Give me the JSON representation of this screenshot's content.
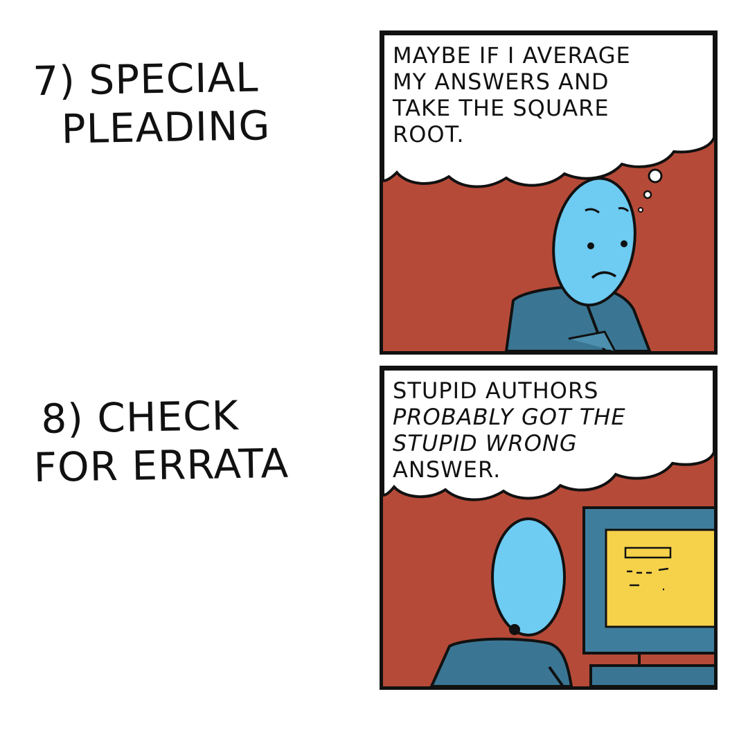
{
  "comic": {
    "step7": {
      "label_lines": [
        "7) SPECIAL",
        "PLEADING"
      ],
      "thought_lines": [
        "MAYBE IF I AVERAGE",
        "MY ANSWERS AND",
        "TAKE THE SQUARE",
        "ROOT."
      ]
    },
    "step8": {
      "label_lines": [
        "8) CHECK",
        "FOR ERRATA"
      ],
      "thought_lines": [
        "STUPID AUTHORS",
        "PROBABLY GOT THE",
        "STUPID WRONG",
        "ANSWER."
      ]
    }
  },
  "colors": {
    "background": "#ffffff",
    "panel": "#b64a38",
    "character_head": "#6ecbf2",
    "character_body": "#3a7693",
    "monitor_frame": "#3f7d9c",
    "monitor_screen": "#f6d24a",
    "ink": "#111111"
  },
  "icons": [
    "thinking-character",
    "computer-monitor",
    "thought-bubble"
  ]
}
